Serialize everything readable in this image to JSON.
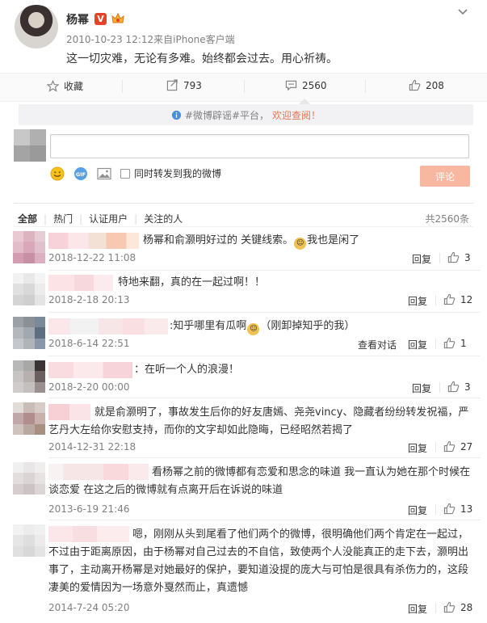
{
  "post": {
    "author": "杨幂",
    "timestamp": "2010-10-23 12:12",
    "source": "来自iPhone客户端",
    "text": "这一切灾难，无论有多难。始终都会过去。用心祈祷。"
  },
  "actions": {
    "favorite": "收藏",
    "repost_count": "793",
    "comment_count": "2560",
    "like_count": "208"
  },
  "notice": {
    "hashtag": "#微博辟谣#平台，",
    "link": "欢迎查阅！"
  },
  "composer": {
    "input_placeholder": "",
    "repost_label": "同时转发到我的微博",
    "submit_label": "评论"
  },
  "filters": {
    "tabs": [
      "全部",
      "热门",
      "认证用户",
      "关注的人"
    ],
    "total": "共2560条"
  },
  "comments": [
    {
      "text": "杨幂和俞灏明好过的 关键线索。",
      "text2": "我也是闲了",
      "time": "2018-12-22 11:08",
      "reply": "回复",
      "likes": "3"
    },
    {
      "text": "特地来翻，真的在一起过啊！！",
      "time": "2018-2-18 20:13",
      "reply": "回复",
      "likes": "12"
    },
    {
      "text": ":知乎哪里有瓜啊",
      "text2": "（刚卸掉知乎的我）",
      "time": "2018-6-14 22:51",
      "extra": "查看对话",
      "reply": "回复",
      "likes": "1"
    },
    {
      "text": "：在听一个人的浪漫！",
      "time": "2018-2-20 00:00",
      "reply": "回复",
      "likes": "3"
    },
    {
      "text": "就是俞灏明了，事故发生后你的好友唐嫣、尧尧vincy、隐藏者纷纷转发祝福，严艺丹大左给你安慰支持，而你的文字却如此隐晦，已经昭然若揭了",
      "time": "2014-12-31 22:18",
      "reply": "回复",
      "likes": "27"
    },
    {
      "text": "看杨幂之前的微博都有恋爱和思念的味道 我一直认为她在那个时候在谈恋爱 在这之后的微博就有点离开后在诉说的味道",
      "time": "2013-6-19 21:46",
      "reply": "回复",
      "likes": "13"
    },
    {
      "text": "嗯，刚刚从头到尾看了他们两个的微博，很明确他们两个肯定在一起过，不过由于距离原因，由于杨幂对自己过去的不自信，致使两个人没能真正的走下去，灏明出事了，主动离开杨幂是对她最好的保护，要知道没提的庞大与可怕是很具有杀伤力的，这段凄美的爱情因为一场意外戛然而止，真遗憾",
      "time": "2014-7-24 05:20",
      "reply": "回复",
      "likes": "28"
    }
  ]
}
